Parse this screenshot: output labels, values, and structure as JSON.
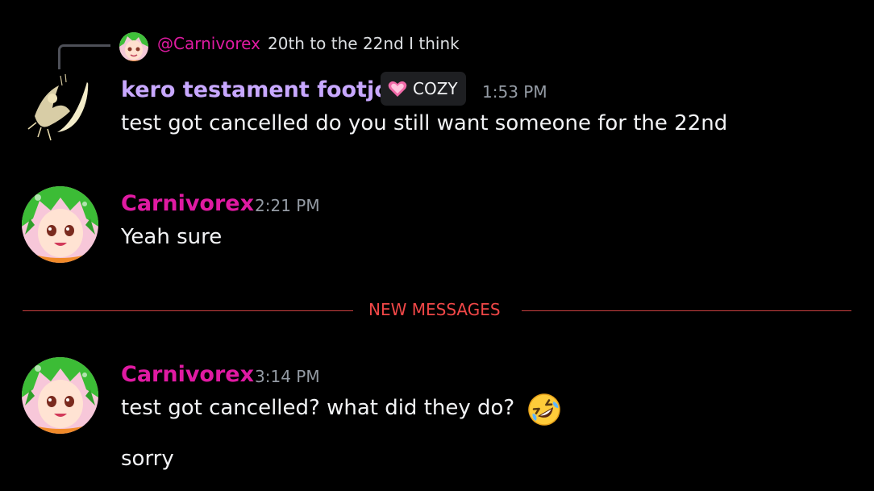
{
  "reply": {
    "author": "@Carnivorex",
    "text": "20th to the 22nd I think"
  },
  "messages": [
    {
      "author": "kero testament footjob",
      "tag": "COZY",
      "time": "1:53 PM",
      "lines": [
        "test got cancelled do you still want someone for the 22nd"
      ]
    },
    {
      "author": "Carnivorex",
      "time": "2:21 PM",
      "lines": [
        "Yeah sure"
      ]
    },
    {
      "author": "Carnivorex",
      "time": "3:14 PM",
      "lines": [
        "test got cancelled? what did they do?",
        "sorry"
      ]
    }
  ],
  "divider": {
    "label": "NEW MESSAGES"
  },
  "colors": {
    "background": "#000000",
    "carnivorex_name": "#e01aa2",
    "kero_name": "#c8a8ff",
    "timestamp": "#949ba4",
    "divider": "#f04747"
  },
  "icons": {
    "tag_icon": "pink-heart-icon",
    "reaction_emoji": "rolling-on-floor-laughing-emoji"
  }
}
